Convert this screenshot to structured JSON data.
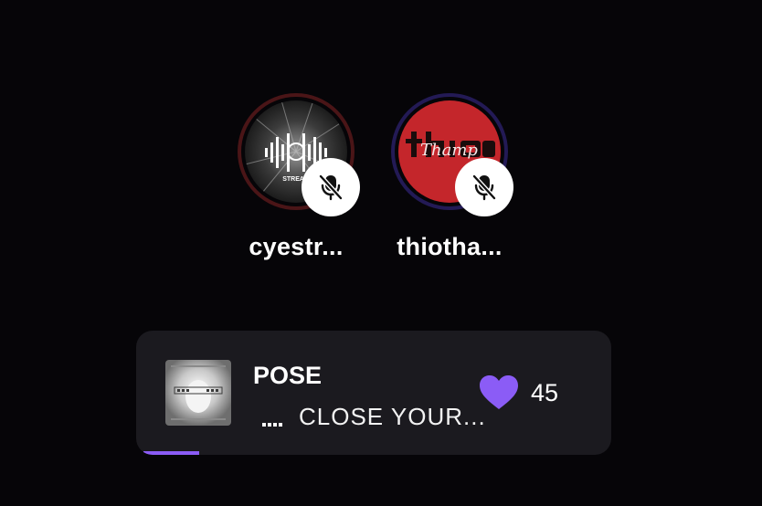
{
  "speakers": [
    {
      "name": "cyestr...",
      "avatar_icon": "stream-logo-avatar",
      "ring_color": "#4a1517",
      "muted": true
    },
    {
      "name": "thiotha...",
      "avatar_icon": "thio-logo-avatar",
      "ring_color": "#231a55",
      "muted": true
    }
  ],
  "now_playing": {
    "title": "POSE",
    "artist": "CLOSE YOUR...",
    "likes": "45",
    "like_icon": "heart-icon",
    "accent_color": "#8b5cf6",
    "progress": 0.12
  }
}
